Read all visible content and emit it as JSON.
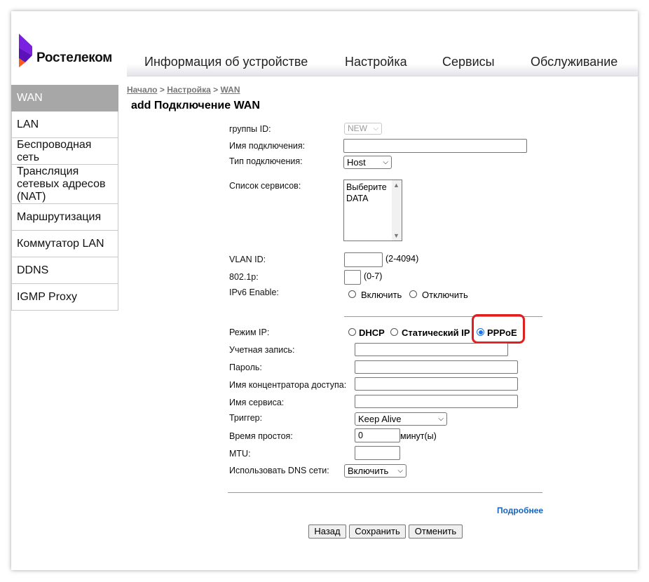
{
  "brand": {
    "name": "Ростелеком",
    "colors": {
      "violet": "#7b1fe0",
      "orange": "#ff5a1f"
    }
  },
  "topnav": {
    "items": [
      "Информация об устройстве",
      "Настройка",
      "Сервисы",
      "Обслуживание"
    ]
  },
  "sidebar": {
    "items": [
      {
        "label": "WAN",
        "active": true
      },
      {
        "label": "LAN"
      },
      {
        "label": "Беспроводная сеть"
      },
      {
        "label": "Трансляция сетевых адресов (NAT)"
      },
      {
        "label": "Маршрутизация"
      },
      {
        "label": "Коммутатор LAN"
      },
      {
        "label": "DDNS"
      },
      {
        "label": "IGMP Proxy"
      }
    ]
  },
  "breadcrumb": {
    "items": [
      "Начало",
      "Настройка",
      "WAN"
    ],
    "separator": ">"
  },
  "page_title": "add Подключение WAN",
  "form": {
    "group_id": {
      "label": "группы ID:",
      "value": "NEW"
    },
    "conn_name": {
      "label": "Имя подключения:",
      "value": ""
    },
    "conn_type": {
      "label": "Тип подключения:",
      "value": "Host"
    },
    "services": {
      "label": "Список сервисов:",
      "options": [
        "Выберите",
        "DATA"
      ]
    },
    "vlan_id": {
      "label": "VLAN ID:",
      "value": "",
      "hint": "(2-4094)"
    },
    "dot1p": {
      "label": "802.1p:",
      "value": "",
      "hint": "(0-7)"
    },
    "ipv6": {
      "label": "IPv6 Enable:",
      "on_label": "Включить",
      "off_label": "Отключить",
      "selected": "none"
    },
    "ip_mode": {
      "label": "Режим IP:",
      "options": [
        "DHCP",
        "Статический IP",
        "PPPoE"
      ],
      "selected": "PPPoE"
    },
    "account": {
      "label": "Учетная запись:",
      "value": ""
    },
    "password": {
      "label": "Пароль:",
      "value": ""
    },
    "ac_name": {
      "label": "Имя концентратора доступа:",
      "value": ""
    },
    "service_name": {
      "label": "Имя сервиса:",
      "value": ""
    },
    "trigger": {
      "label": "Триггер:",
      "value": "Keep Alive"
    },
    "idle_time": {
      "label": "Время простоя:",
      "value": "0",
      "unit": "минут(ы)"
    },
    "mtu": {
      "label": "MTU:",
      "value": ""
    },
    "use_dns": {
      "label": "Использовать DNS сети:",
      "value": "Включить"
    }
  },
  "more_link": "Подробнее",
  "buttons": {
    "back": "Назад",
    "save": "Сохранить",
    "cancel": "Отменить"
  }
}
